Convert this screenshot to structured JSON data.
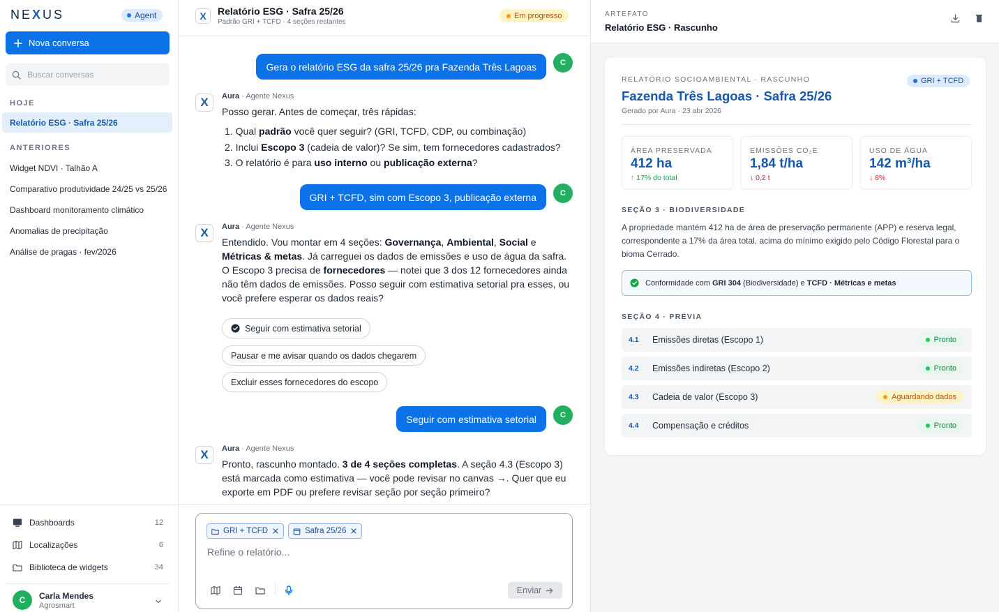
{
  "sidebar": {
    "brand_left": "NE",
    "brand_x": "X",
    "brand_right": "US",
    "agent_badge": "Agent",
    "new_chat": "Nova conversa",
    "search_placeholder": "Buscar conversas",
    "today_label": "HOJE",
    "active_conversation": "Relatório ESG · Safra 25/26",
    "earlier_label": "ANTERIORES",
    "earlier": [
      "Widget NDVI · Talhão A",
      "Comparativo produtividade 24/25 vs 25/26",
      "Dashboard monitoramento climático",
      "Anomalias de precipitação",
      "Análise de pragas · fev/2026"
    ],
    "nav": [
      {
        "label": "Dashboards",
        "count": "12",
        "icon": "dashboard-icon"
      },
      {
        "label": "Localizações",
        "count": "6",
        "icon": "map-icon"
      },
      {
        "label": "Biblioteca de widgets",
        "count": "34",
        "icon": "folder-icon"
      }
    ],
    "user": {
      "initial": "C",
      "name": "Carla Mendes",
      "org": "Agrosmart"
    }
  },
  "chat": {
    "title": "Relatório ESG · Safra 25/26",
    "subtitle": "Padrão GRI + TCFD · 4 seções restantes",
    "status": "Em progresso",
    "user_initial": "C",
    "agent_name": "Aura",
    "agent_role": "· Agente Nexus",
    "msg1": "Gera o relatório ESG da safra 25/26 pra Fazenda Três Lagoas",
    "a1_intro": "Posso gerar. Antes de começar, três rápidas:",
    "a1_items": [
      {
        "n": "1.",
        "pre": "Qual ",
        "b": "padrão",
        "post": " você quer seguir? (GRI, TCFD, CDP, ou combinação)"
      },
      {
        "n": "2.",
        "pre": "Inclui ",
        "b": "Escopo 3",
        "post": " (cadeia de valor)? Se sim, tem fornecedores cadastrados?"
      },
      {
        "n": "3.",
        "pre": "O relatório é para ",
        "b": "uso interno",
        "mid": " ou ",
        "b2": "publicação externa",
        "post": "?"
      }
    ],
    "msg2": "GRI + TCFD, sim com Escopo 3, publicação externa",
    "a2": {
      "t1": "Entendido. Vou montar em 4 seções: ",
      "b1": "Governança",
      "s1": ", ",
      "b2": "Ambiental",
      "s2": ", ",
      "b3": "Social",
      "s3": " e ",
      "b4": "Métricas & metas",
      "t2": ". Já carreguei os dados de emissões e uso de água da safra. O Escopo 3 precisa de ",
      "b5": "fornecedores",
      "t3": " — notei que 3 dos 12 fornecedores ainda não têm dados de emissões. Posso seguir com estimativa setorial pra esses, ou você prefere esperar os dados reais?"
    },
    "options": [
      "Seguir com estimativa setorial",
      "Pausar e me avisar quando os dados chegarem",
      "Excluir esses fornecedores do escopo"
    ],
    "msg3": "Seguir com estimativa setorial",
    "a3": {
      "t1": "Pronto, rascunho montado. ",
      "b1": "3 de 4 seções completas",
      "t2": ". A seção 4.3 (Escopo 3) está marcada como estimativa — você pode revisar no canvas →. Quer que eu exporte em PDF ou prefere revisar seção por seção primeiro?"
    },
    "composer": {
      "chip1": "GRI + TCFD",
      "chip2": "Safra 25/26",
      "placeholder": "Refine o relatório...",
      "send": "Enviar"
    }
  },
  "artifact": {
    "label": "ARTEFATO",
    "title": "Relatório ESG · Rascunho",
    "card": {
      "label": "RELATÓRIO SOCIOAMBIENTAL · RASCUNHO",
      "tag": "GRI + TCFD",
      "title": "Fazenda Três Lagoas · Safra 25/26",
      "generated": "Gerado por Aura · 23 abr 2026",
      "metrics": [
        {
          "label": "ÁREA PRESERVADA",
          "value": "412 ha",
          "delta": "↑ 17% do total",
          "dir": "up"
        },
        {
          "label": "EMISSÕES CO₂E",
          "value": "1,84 t/ha",
          "delta": "↓ 0,2 t",
          "dir": "down"
        },
        {
          "label": "USO DE ÁGUA",
          "value": "142 m³/ha",
          "delta": "↓ 8%",
          "dir": "down"
        }
      ],
      "section3_label": "SEÇÃO 3 · BIODIVERSIDADE",
      "section3_text": "A propriedade mantém 412 ha de área de preservação permanente (APP) e reserva legal, correspondente a 17% da área total, acima do mínimo exigido pelo Código Florestal para o bioma Cerrado.",
      "compliance": {
        "t1": "Conformidade com ",
        "b1": "GRI 304",
        "t2": " (Biodiversidade) e ",
        "b2": "TCFD · Métricas e metas"
      },
      "section4_label": "SEÇÃO 4 · PRÉVIA",
      "preview": [
        {
          "num": "4.1",
          "name": "Emissões diretas (Escopo 1)",
          "status": "Pronto",
          "kind": "ok"
        },
        {
          "num": "4.2",
          "name": "Emissões indiretas (Escopo 2)",
          "status": "Pronto",
          "kind": "ok"
        },
        {
          "num": "4.3",
          "name": "Cadeia de valor (Escopo 3)",
          "status": "Aguardando dados",
          "kind": "wait"
        },
        {
          "num": "4.4",
          "name": "Compensação e créditos",
          "status": "Pronto",
          "kind": "ok"
        }
      ]
    }
  },
  "colors": {
    "accent": "#0b72e7",
    "brand": "#1558b0",
    "success": "#22b060",
    "warning": "#f59e0b"
  }
}
